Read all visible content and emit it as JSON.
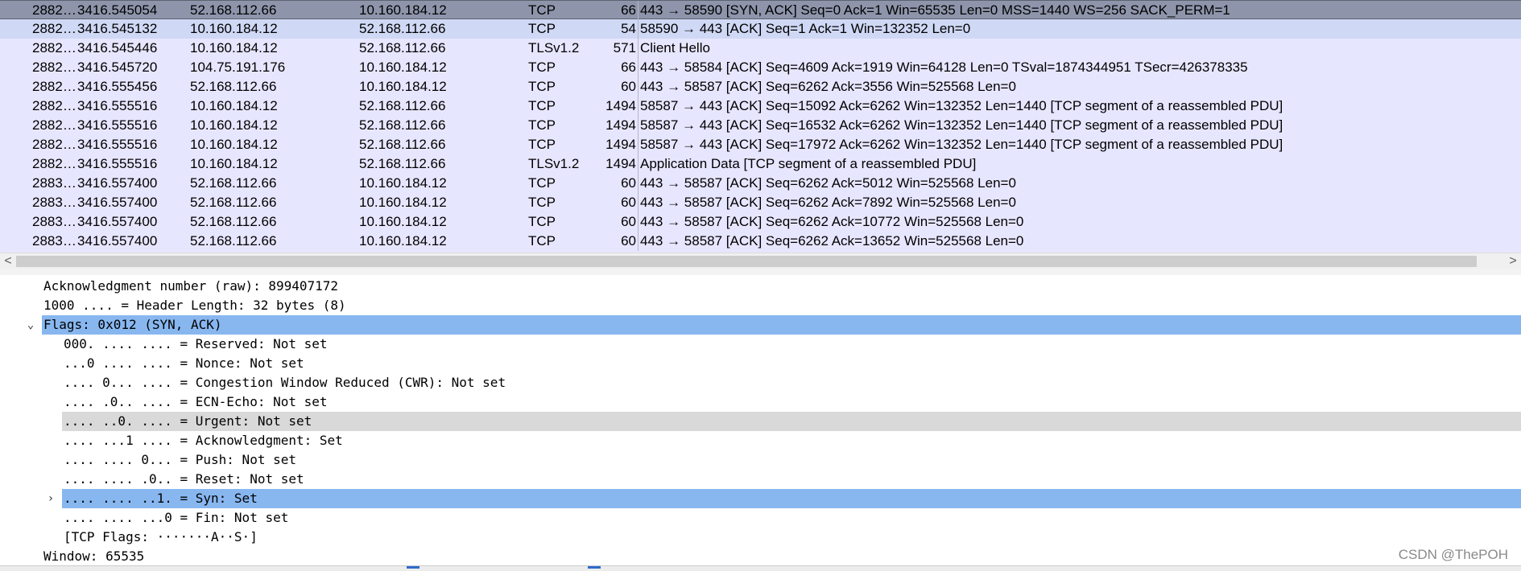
{
  "packet_list": {
    "rows": [
      {
        "no": "2882…",
        "time": "3416.545054",
        "src": "52.168.112.66",
        "dst": "10.160.184.12",
        "proto": "TCP",
        "len": "66",
        "info": "443 → 58590 [SYN, ACK] Seq=0 Ack=1 Win=65535 Len=0 MSS=1440 WS=256 SACK_PERM=1",
        "state": "selected"
      },
      {
        "no": "2882…",
        "time": "3416.545132",
        "src": "10.160.184.12",
        "dst": "52.168.112.66",
        "proto": "TCP",
        "len": "54",
        "info": "58590 → 443 [ACK] Seq=1 Ack=1 Win=132352 Len=0",
        "state": "related"
      },
      {
        "no": "2882…",
        "time": "3416.545446",
        "src": "10.160.184.12",
        "dst": "52.168.112.66",
        "proto": "TLSv1.2",
        "len": "571",
        "info": "Client Hello",
        "state": ""
      },
      {
        "no": "2882…",
        "time": "3416.545720",
        "src": "104.75.191.176",
        "dst": "10.160.184.12",
        "proto": "TCP",
        "len": "66",
        "info": "443 → 58584 [ACK] Seq=4609 Ack=1919 Win=64128 Len=0 TSval=1874344951 TSecr=426378335",
        "state": ""
      },
      {
        "no": "2882…",
        "time": "3416.555456",
        "src": "52.168.112.66",
        "dst": "10.160.184.12",
        "proto": "TCP",
        "len": "60",
        "info": "443 → 58587 [ACK] Seq=6262 Ack=3556 Win=525568 Len=0",
        "state": ""
      },
      {
        "no": "2882…",
        "time": "3416.555516",
        "src": "10.160.184.12",
        "dst": "52.168.112.66",
        "proto": "TCP",
        "len": "1494",
        "info": "58587 → 443 [ACK] Seq=15092 Ack=6262 Win=132352 Len=1440 [TCP segment of a reassembled PDU]",
        "state": ""
      },
      {
        "no": "2882…",
        "time": "3416.555516",
        "src": "10.160.184.12",
        "dst": "52.168.112.66",
        "proto": "TCP",
        "len": "1494",
        "info": "58587 → 443 [ACK] Seq=16532 Ack=6262 Win=132352 Len=1440 [TCP segment of a reassembled PDU]",
        "state": ""
      },
      {
        "no": "2882…",
        "time": "3416.555516",
        "src": "10.160.184.12",
        "dst": "52.168.112.66",
        "proto": "TCP",
        "len": "1494",
        "info": "58587 → 443 [ACK] Seq=17972 Ack=6262 Win=132352 Len=1440 [TCP segment of a reassembled PDU]",
        "state": ""
      },
      {
        "no": "2882…",
        "time": "3416.555516",
        "src": "10.160.184.12",
        "dst": "52.168.112.66",
        "proto": "TLSv1.2",
        "len": "1494",
        "info": "Application Data [TCP segment of a reassembled PDU]",
        "state": ""
      },
      {
        "no": "2883…",
        "time": "3416.557400",
        "src": "52.168.112.66",
        "dst": "10.160.184.12",
        "proto": "TCP",
        "len": "60",
        "info": "443 → 58587 [ACK] Seq=6262 Ack=5012 Win=525568 Len=0",
        "state": ""
      },
      {
        "no": "2883…",
        "time": "3416.557400",
        "src": "52.168.112.66",
        "dst": "10.160.184.12",
        "proto": "TCP",
        "len": "60",
        "info": "443 → 58587 [ACK] Seq=6262 Ack=7892 Win=525568 Len=0",
        "state": ""
      },
      {
        "no": "2883…",
        "time": "3416.557400",
        "src": "52.168.112.66",
        "dst": "10.160.184.12",
        "proto": "TCP",
        "len": "60",
        "info": "443 → 58587 [ACK] Seq=6262 Ack=10772 Win=525568 Len=0",
        "state": ""
      },
      {
        "no": "2883…",
        "time": "3416.557400",
        "src": "52.168.112.66",
        "dst": "10.160.184.12",
        "proto": "TCP",
        "len": "60",
        "info": "443 → 58587 [ACK] Seq=6262 Ack=13652 Win=525568 Len=0",
        "state": ""
      }
    ]
  },
  "scrollbar": {
    "left_arrow": "<",
    "right_arrow": ">"
  },
  "details": {
    "lines": [
      {
        "text": "Acknowledgment number (raw): 899407172",
        "indent": 0,
        "expander": "",
        "state": ""
      },
      {
        "text": "1000 .... = Header Length: 32 bytes (8)",
        "indent": 0,
        "expander": "",
        "state": ""
      },
      {
        "text": "Flags: 0x012 (SYN, ACK)",
        "indent": 0,
        "expander": "⌄",
        "state": "sel-blue"
      },
      {
        "text": "000. .... .... = Reserved: Not set",
        "indent": 1,
        "expander": "",
        "state": ""
      },
      {
        "text": "...0 .... .... = Nonce: Not set",
        "indent": 1,
        "expander": "",
        "state": ""
      },
      {
        "text": ".... 0... .... = Congestion Window Reduced (CWR): Not set",
        "indent": 1,
        "expander": "",
        "state": ""
      },
      {
        "text": ".... .0.. .... = ECN-Echo: Not set",
        "indent": 1,
        "expander": "",
        "state": ""
      },
      {
        "text": ".... ..0. .... = Urgent: Not set",
        "indent": 1,
        "expander": "",
        "state": "sel-grey"
      },
      {
        "text": ".... ...1 .... = Acknowledgment: Set",
        "indent": 1,
        "expander": "",
        "state": ""
      },
      {
        "text": ".... .... 0... = Push: Not set",
        "indent": 1,
        "expander": "",
        "state": ""
      },
      {
        "text": ".... .... .0.. = Reset: Not set",
        "indent": 1,
        "expander": "",
        "state": ""
      },
      {
        "text": ".... .... ..1. = Syn: Set",
        "indent": 1,
        "expander": "›",
        "state": "sel-blue"
      },
      {
        "text": ".... .... ...0 = Fin: Not set",
        "indent": 1,
        "expander": "",
        "state": ""
      },
      {
        "text": "[TCP Flags: ·······A··S·]",
        "indent": 1,
        "expander": "",
        "state": ""
      },
      {
        "text": "Window: 65535",
        "indent": 0,
        "expander": "",
        "state": ""
      }
    ]
  },
  "watermark": "CSDN @ThePOH",
  "colors": {
    "list_bg": "#e7e6ff",
    "selected": "#8e95ab",
    "related": "#cfd8f4",
    "tree_select": "#88b7f0",
    "tree_hover": "#d9d9d9"
  }
}
